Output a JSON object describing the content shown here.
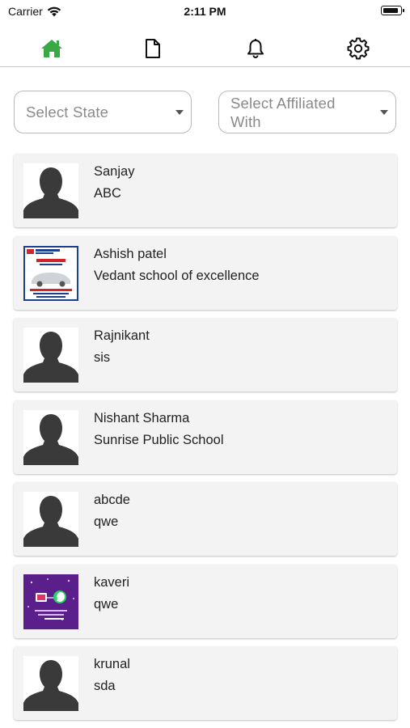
{
  "status_bar": {
    "carrier": "Carrier",
    "time": "2:11 PM"
  },
  "nav": {
    "active_color": "#3aa845",
    "icon_color": "#111111",
    "items": [
      {
        "icon": "home-icon",
        "active": true
      },
      {
        "icon": "document-icon",
        "active": false
      },
      {
        "icon": "bell-icon",
        "active": false
      },
      {
        "icon": "gear-icon",
        "active": false
      }
    ]
  },
  "filters": {
    "state": {
      "placeholder": "Select State"
    },
    "affiliated": {
      "placeholder": "Select Affiliated With"
    }
  },
  "contacts": [
    {
      "name": "Sanjay",
      "school": "ABC",
      "avatar": "person-silhouette"
    },
    {
      "name": "Ashish patel",
      "school": "Vedant school of excellence",
      "avatar": "hdfc-bank-ad-thumbnail"
    },
    {
      "name": "Rajnikant",
      "school": "sis",
      "avatar": "person-silhouette"
    },
    {
      "name": "Nishant Sharma",
      "school": "Sunrise Public School",
      "avatar": "person-silhouette"
    },
    {
      "name": "abcde",
      "school": "qwe",
      "avatar": "person-silhouette"
    },
    {
      "name": "kaveri",
      "school": "qwe",
      "avatar": "whatsapp-promo-thumbnail"
    },
    {
      "name": "krunal",
      "school": "sda",
      "avatar": "person-silhouette"
    }
  ]
}
